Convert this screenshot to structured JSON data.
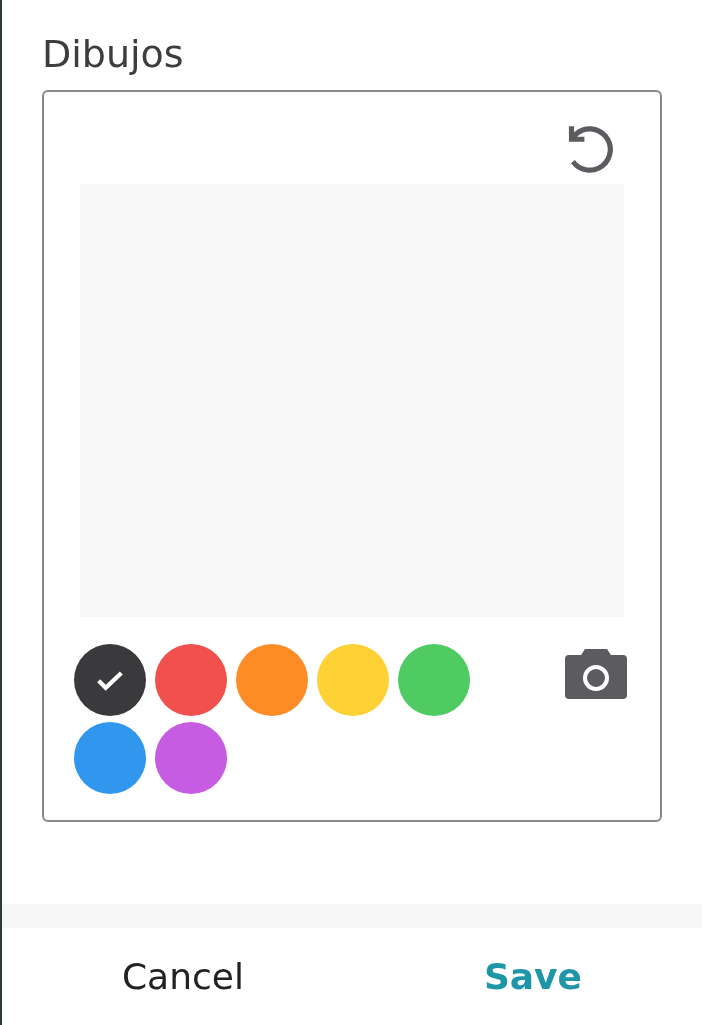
{
  "title": "Dibujos",
  "colors": [
    {
      "color": "#3a3a3c",
      "selected": true
    },
    {
      "color": "#f24f4f",
      "selected": false
    },
    {
      "color": "#fd8c24",
      "selected": false
    },
    {
      "color": "#fed134",
      "selected": false
    },
    {
      "color": "#4fcb62",
      "selected": false
    },
    {
      "color": "#3196ee",
      "selected": false
    },
    {
      "color": "#c55ce2",
      "selected": false
    }
  ],
  "buttons": [
    {
      "label": "Cancel",
      "kind": "secondary"
    },
    {
      "label": "Save",
      "kind": "primary"
    }
  ]
}
